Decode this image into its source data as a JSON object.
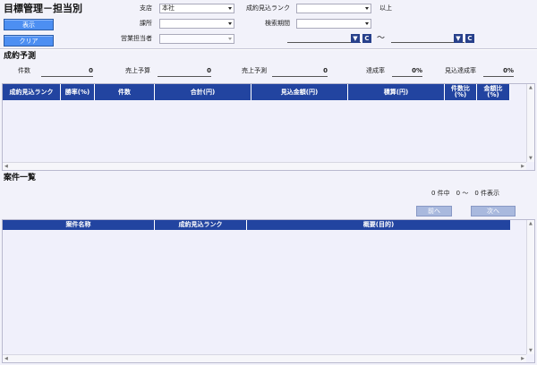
{
  "header": {
    "title": "目標管理－担当別",
    "show_button": "表示",
    "clear_button": "クリア"
  },
  "filters": {
    "branch_label": "支店",
    "branch_value": "本社",
    "division_label": "課所",
    "division_value": "",
    "rep_label": "営業担当者",
    "rep_value": "",
    "rank_label": "成約見込ランク",
    "rank_value": "",
    "rank_suffix": "以上",
    "period_label": "検索期間",
    "period_value": "",
    "date_from": "",
    "date_to": "",
    "date_sep": "～",
    "calendar_button": "▼",
    "clear_date_button": "C"
  },
  "forecast": {
    "title": "成約予測",
    "count_label": "件数",
    "count_value": "0",
    "budget_label": "売上予算",
    "budget_value": "0",
    "prediction_label": "売上予測",
    "prediction_value": "0",
    "achievement_label": "達成率",
    "achievement_value": "0%",
    "expected_achievement_label": "見込達成率",
    "expected_achievement_value": "0%"
  },
  "forecast_table": {
    "columns": [
      "成約見込ランク",
      "勝率(%)",
      "件数",
      "合計(円)",
      "見込金額(円)",
      "積算(円)",
      "件数比(%)",
      "金額比(%)"
    ]
  },
  "cases": {
    "title": "案件一覧",
    "count_text": "0 件中　0 ～　0 件表示",
    "prev_button": "前へ",
    "next_button": "次へ",
    "columns": [
      "案件名称",
      "成約見込ランク",
      "概要(目的)"
    ]
  },
  "scroll_glyphs": {
    "up": "▲",
    "down": "▼",
    "left": "◀",
    "right": "▶"
  },
  "colors": {
    "header_blue": "#2244a0",
    "button_blue": "#4d8ff2",
    "background": "#f2f2fa"
  }
}
